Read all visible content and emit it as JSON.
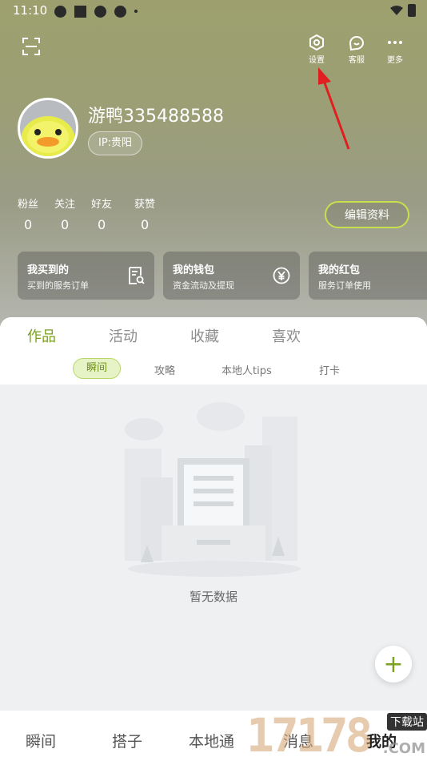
{
  "status_bar": {
    "time": "11:10"
  },
  "header": {
    "actions": [
      {
        "label": "设置",
        "icon": "settings-icon"
      },
      {
        "label": "客服",
        "icon": "customer-service-icon"
      },
      {
        "label": "更多",
        "icon": "more-icon"
      }
    ]
  },
  "profile": {
    "username": "游鸭335488588",
    "ip_location": "IP:贵阳",
    "edit_label": "编辑资料"
  },
  "stats": [
    {
      "label": "粉丝",
      "value": "0"
    },
    {
      "label": "关注",
      "value": "0"
    },
    {
      "label": "好友",
      "value": "0"
    },
    {
      "label": "获赞",
      "value": "0"
    }
  ],
  "cards": [
    {
      "title": "我买到的",
      "subtitle": "买到的服务订单",
      "icon": "orders-icon"
    },
    {
      "title": "我的钱包",
      "subtitle": "资金流动及提现",
      "icon": "yuan-icon"
    },
    {
      "title": "我的红包",
      "subtitle": "服务订单使用",
      "icon": "red-packet-icon"
    }
  ],
  "content_tabs": [
    "作品",
    "活动",
    "收藏",
    "喜欢"
  ],
  "active_content_tab": "作品",
  "sub_tabs": [
    "瞬间",
    "攻略",
    "本地人tips",
    "打卡"
  ],
  "active_sub_tab": "瞬间",
  "empty_state": {
    "text": "暂无数据"
  },
  "bottom_nav": [
    "瞬间",
    "搭子",
    "本地通",
    "消息",
    "我的"
  ],
  "active_bottom_nav": "我的",
  "watermark": {
    "digits": "17178",
    "tag": "下载站",
    "sub": ".COM"
  },
  "colors": {
    "accent": "#7aa01e",
    "accent_border": "#c7e04e",
    "header_bg": "#9c9f74"
  }
}
